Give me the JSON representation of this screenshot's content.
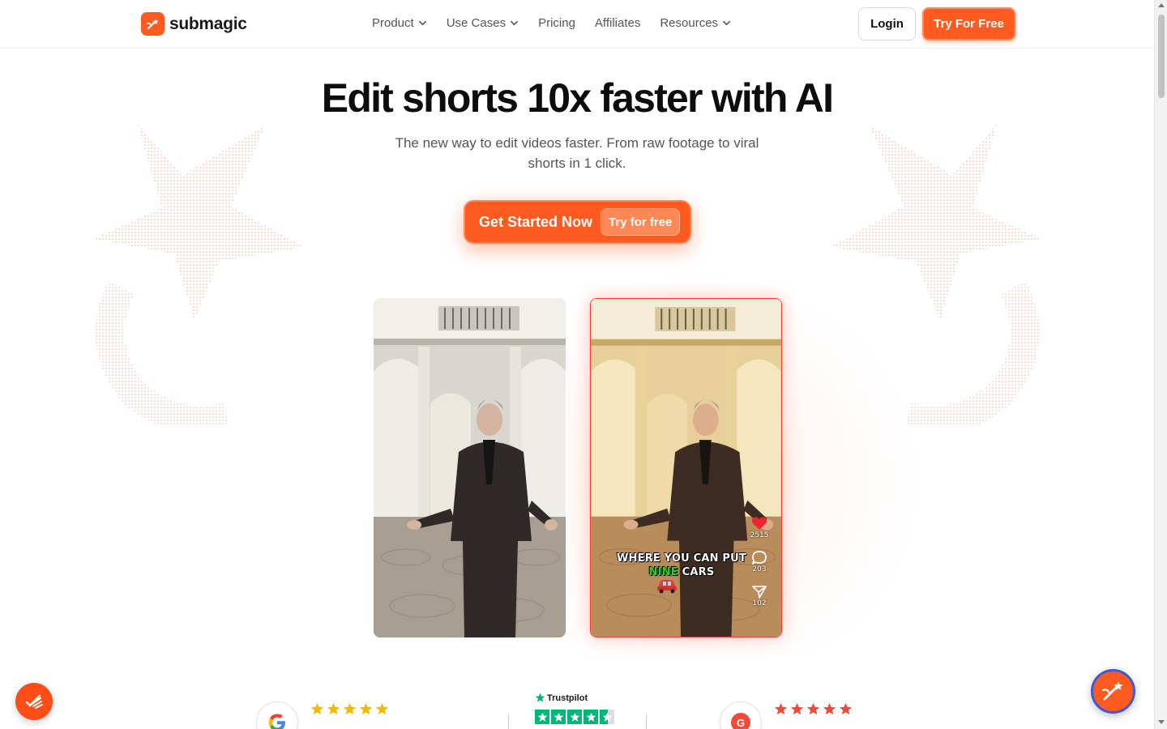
{
  "header": {
    "logo_text": "submagic",
    "nav": [
      {
        "label": "Product",
        "has_dropdown": true
      },
      {
        "label": "Use Cases",
        "has_dropdown": true
      },
      {
        "label": "Pricing",
        "has_dropdown": false
      },
      {
        "label": "Affiliates",
        "has_dropdown": false
      },
      {
        "label": "Resources",
        "has_dropdown": true
      }
    ],
    "login_label": "Login",
    "try_label": "Try For Free"
  },
  "hero": {
    "title": "Edit shorts 10x faster with AI",
    "subtitle": "The new way to edit videos faster. From raw footage to viral shorts in 1 click.",
    "cta_label": "Get Started Now",
    "cta_pill": "Try for free"
  },
  "video_demo": {
    "caption_line1": "WHERE YOU CAN PUT",
    "caption_highlight": "NINE",
    "caption_rest": "CARS",
    "likes": "2515",
    "comments": "203",
    "shares": "102"
  },
  "reviews": {
    "trustpilot_label": "Trustpilot"
  },
  "colors": {
    "brand": "#ff5a1f",
    "highlight_green": "#22d32b",
    "star_yellow": "#f5b800",
    "star_red": "#ef4b3a",
    "trustpilot_green": "#00b67a"
  },
  "icons": [
    "logo-magic-wand-icon",
    "chevron-down-icon",
    "heart-icon",
    "comment-icon",
    "share-icon",
    "car-emoji-icon",
    "google-icon",
    "g2-icon",
    "star-icon",
    "chat-widget-icon",
    "submagic-widget-icon"
  ]
}
